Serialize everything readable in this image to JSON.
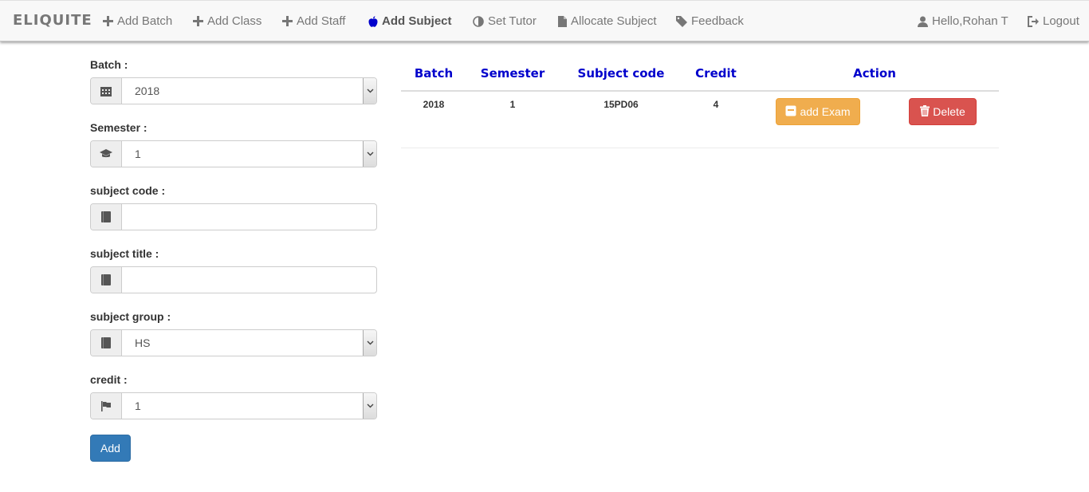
{
  "nav": {
    "brand": "ELIQUITE",
    "items": [
      {
        "label": "Add Batch",
        "icon": "plus-icon"
      },
      {
        "label": "Add Class",
        "icon": "plus-icon"
      },
      {
        "label": "Add Staff",
        "icon": "plus-icon"
      },
      {
        "label": "Add Subject",
        "icon": "apple-icon",
        "active": true
      },
      {
        "label": "Set Tutor",
        "icon": "adjust-icon"
      },
      {
        "label": "Allocate Subject",
        "icon": "file-icon"
      },
      {
        "label": "Feedback",
        "icon": "tag-icon"
      }
    ],
    "user": {
      "label": "Hello,Rohan T",
      "icon": "user-icon"
    },
    "logout": {
      "label": "Logout",
      "icon": "logout-icon"
    }
  },
  "form": {
    "batch": {
      "label": "Batch :",
      "value": "2018",
      "icon": "calendar-icon"
    },
    "semester": {
      "label": "Semester :",
      "value": "1",
      "icon": "graduation-cap-icon"
    },
    "subject_code": {
      "label": "subject code :",
      "value": "",
      "icon": "book-icon"
    },
    "subject_title": {
      "label": "subject title :",
      "value": "",
      "icon": "book-icon"
    },
    "subject_group": {
      "label": "subject group :",
      "value": "HS",
      "icon": "book-icon"
    },
    "credit": {
      "label": "credit :",
      "value": "1",
      "icon": "flag-icon"
    },
    "add_button": "Add"
  },
  "table": {
    "headers": [
      "Batch",
      "Semester",
      "Subject code",
      "Credit",
      "Action"
    ],
    "rows": [
      {
        "batch": "2018",
        "semester": "1",
        "subject_code": "15PD06",
        "credit": "4",
        "add_exam_label": "add Exam",
        "delete_label": "Delete"
      }
    ]
  },
  "colors": {
    "header_text": "#0000cc",
    "primary": "#337ab7",
    "warning": "#f0ad4e",
    "danger": "#d9534f"
  }
}
